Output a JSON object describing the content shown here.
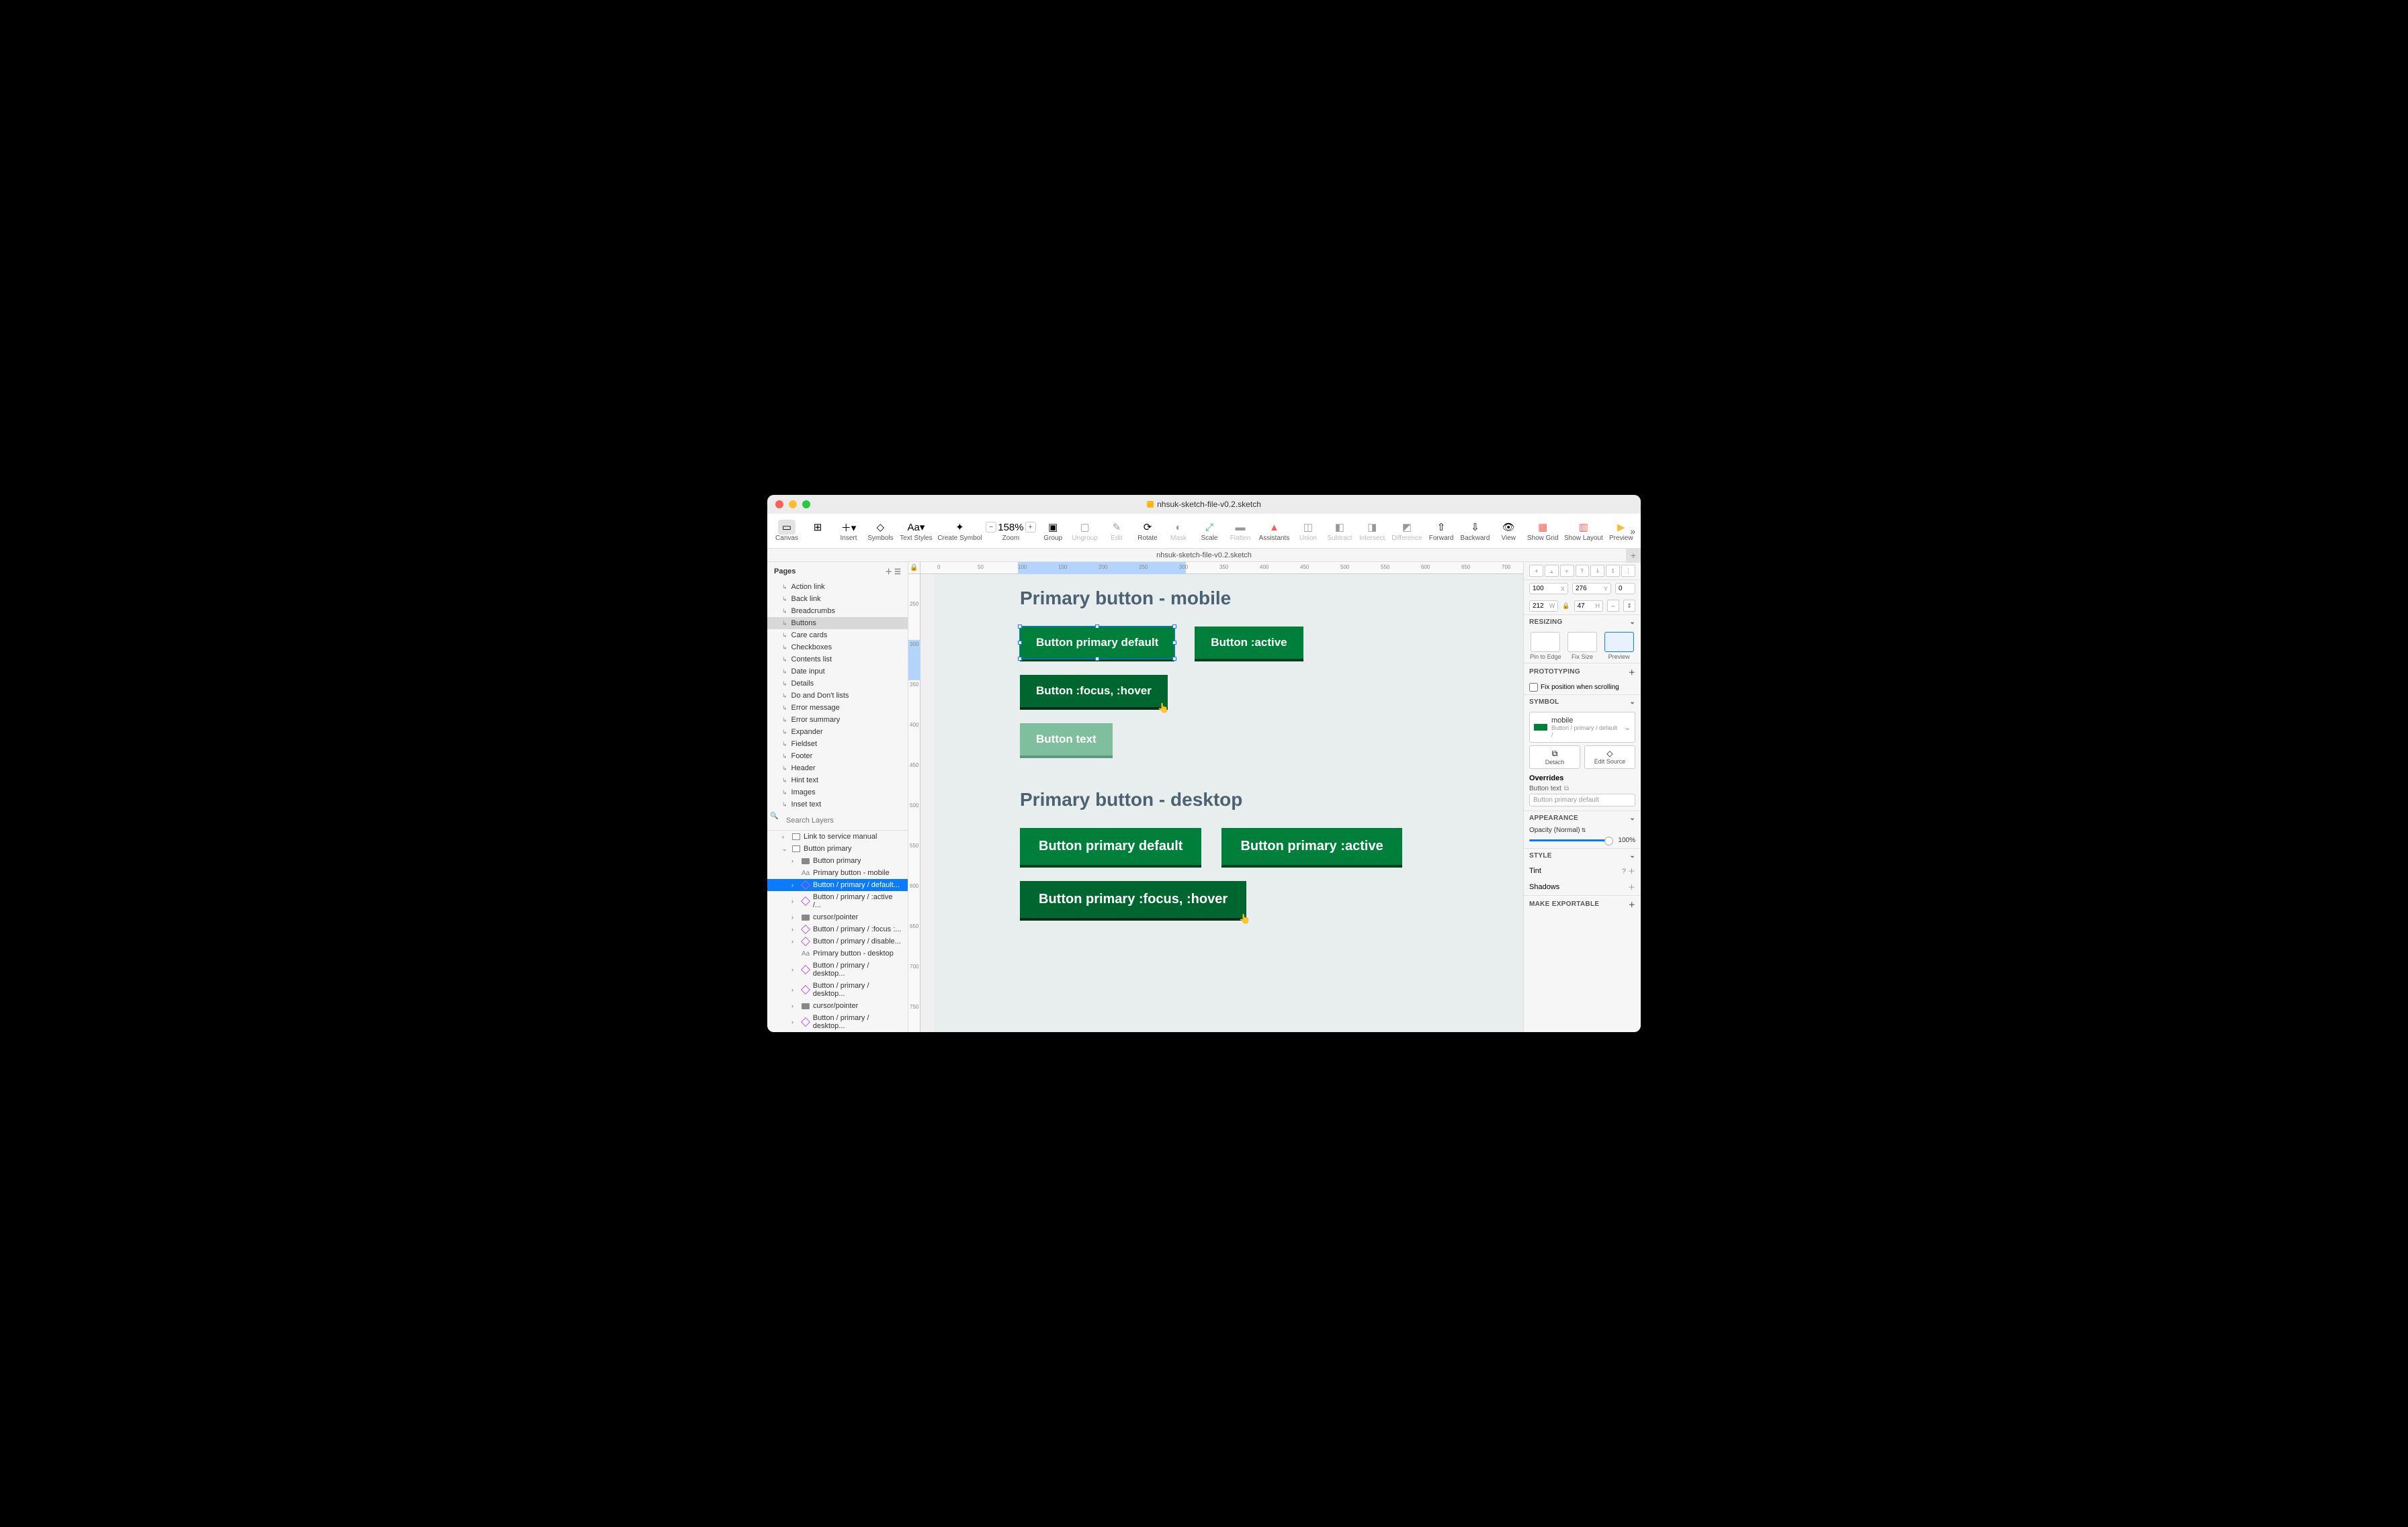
{
  "window": {
    "title": "nhsuk-sketch-file-v0.2.sketch"
  },
  "tab": {
    "label": "nhsuk-sketch-file-v0.2.sketch"
  },
  "toolbar": {
    "canvas": "Canvas",
    "insert": "Insert",
    "symbols": "Symbols",
    "textstyles": "Text Styles",
    "createsymbol": "Create Symbol",
    "zoom": "Zoom",
    "zoomval": "158%",
    "group": "Group",
    "ungroup": "Ungroup",
    "edit": "Edit",
    "rotate": "Rotate",
    "mask": "Mask",
    "scale": "Scale",
    "flatten": "Flatten",
    "assistants": "Assistants",
    "union": "Union",
    "subtract": "Subtract",
    "intersect": "Intersect",
    "difference": "Difference",
    "forward": "Forward",
    "backward": "Backward",
    "view": "View",
    "showgrid": "Show Grid",
    "showlayout": "Show Layout",
    "preview": "Preview"
  },
  "pages": {
    "header": "Pages",
    "items": [
      "Action link",
      "Back link",
      "Breadcrumbs",
      "Buttons",
      "Care cards",
      "Checkboxes",
      "Contents list",
      "Date input",
      "Details",
      "Do and Don't lists",
      "Error message",
      "Error summary",
      "Expander",
      "Fieldset",
      "Footer",
      "Header",
      "Hint text",
      "Images",
      "Inset text"
    ],
    "selectedIndex": 3
  },
  "search": {
    "placeholder": "Search Layers"
  },
  "layers": [
    {
      "d": 1,
      "t": "art",
      "txt": "Link to service manual",
      "arrow": "›"
    },
    {
      "d": 1,
      "t": "art",
      "txt": "Button primary",
      "arrow": "⌄"
    },
    {
      "d": 2,
      "t": "fold",
      "txt": "Button primary",
      "arrow": "›"
    },
    {
      "d": 2,
      "t": "txt",
      "txt": "Primary button - mobile",
      "arrow": ""
    },
    {
      "d": 2,
      "t": "sym",
      "txt": "Button / primary / default...",
      "arrow": "›",
      "sel": true
    },
    {
      "d": 2,
      "t": "sym",
      "txt": "Button / primary / :active /...",
      "arrow": "›"
    },
    {
      "d": 2,
      "t": "fold",
      "txt": "cursor/pointer",
      "arrow": "›"
    },
    {
      "d": 2,
      "t": "sym",
      "txt": "Button / primary / :focus :...",
      "arrow": "›"
    },
    {
      "d": 2,
      "t": "sym",
      "txt": "Button / primary / disable...",
      "arrow": "›"
    },
    {
      "d": 2,
      "t": "txt",
      "txt": "Primary button - desktop",
      "arrow": ""
    },
    {
      "d": 2,
      "t": "sym",
      "txt": "Button / primary / desktop...",
      "arrow": "›"
    },
    {
      "d": 2,
      "t": "sym",
      "txt": "Button / primary / desktop...",
      "arrow": "›"
    },
    {
      "d": 2,
      "t": "fold",
      "txt": "cursor/pointer",
      "arrow": "›"
    },
    {
      "d": 2,
      "t": "sym",
      "txt": "Button / primary / desktop...",
      "arrow": "›"
    },
    {
      "d": 2,
      "t": "sym",
      "txt": "Button / primary / desktop...",
      "arrow": "›"
    }
  ],
  "canvas": {
    "title1": "Primary button - mobile",
    "title2": "Primary button - desktop",
    "btn_default": "Button primary default",
    "btn_active": "Button :active",
    "btn_hover": "Button :focus, :hover",
    "btn_disabled": "Button text",
    "btn_d_default": "Button primary default",
    "btn_d_active": "Button primary :active",
    "btn_d_hover": "Button primary :focus, :hover"
  },
  "ruler_h": [
    "0",
    "50",
    "100",
    "150",
    "200",
    "250",
    "300",
    "350",
    "400",
    "450",
    "500",
    "550",
    "600",
    "650",
    "700"
  ],
  "ruler_v": [
    "250",
    "300",
    "350",
    "400",
    "450",
    "500",
    "550",
    "600",
    "650",
    "700",
    "750"
  ],
  "inspector": {
    "x": "100",
    "y": "276",
    "w": "212",
    "h": "47",
    "rot": "0",
    "resizing": "RESIZING",
    "pin": "Pin to Edge",
    "fix": "Fix Size",
    "preview": "Preview",
    "proto": "PROTOTYPING",
    "fixpos": "Fix position when scrolling",
    "symbol": "SYMBOL",
    "symname": "mobile",
    "sympath": "Button / primary / default /",
    "detach": "Detach",
    "editsrc": "Edit Source",
    "overrides": "Overrides",
    "ovlabel": "Button text",
    "ovplaceholder": "Button primary default",
    "appearance": "APPEARANCE",
    "opacity": "Opacity (Normal)",
    "opval": "100%",
    "style": "STYLE",
    "tint": "Tint",
    "shadows": "Shadows",
    "export": "MAKE EXPORTABLE"
  }
}
